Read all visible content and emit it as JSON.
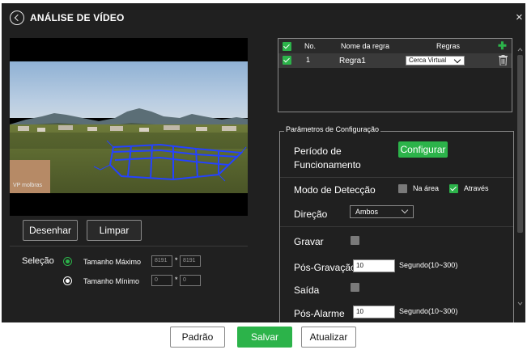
{
  "colors": {
    "accent": "#2cb34a",
    "panel": "#202020",
    "virtual_fence": "#2442ff"
  },
  "header": {
    "title": "ANÁLISE DE VÍDEO",
    "back_icon": "back-circle-icon",
    "close_icon": "close-icon",
    "close_glyph": "×"
  },
  "video": {
    "watermark": "VP molbras"
  },
  "drawing": {
    "draw_label": "Desenhar",
    "clear_label": "Limpar"
  },
  "selection": {
    "label": "Seleção",
    "max": {
      "label": "Tamanho Máximo",
      "w": "8191",
      "h": "8191",
      "selected": true
    },
    "min": {
      "label": "Tamanho Mínimo",
      "w": "0",
      "h": "0",
      "selected": false
    },
    "separator": "*"
  },
  "rules_table": {
    "headers": {
      "no": "No.",
      "name": "Nome da regra",
      "rules": "Regras"
    },
    "add_icon": "plus-icon",
    "add_glyph": "✚",
    "rows": [
      {
        "no": "1",
        "name": "Regra1",
        "rule": "Cerca Virtual",
        "checked": true
      }
    ]
  },
  "params": {
    "legend": "Parâmetros de Configuração",
    "period_label_1": "Período de",
    "period_label_2": "Funcionamento",
    "configure_label": "Configurar",
    "detection_label": "Modo de Detecção",
    "in_area_label": "Na área",
    "in_area_checked": false,
    "through_label": "Através",
    "through_checked": true,
    "direction_label": "Direção",
    "direction_value": "Ambos",
    "record_label": "Gravar",
    "record_checked": false,
    "post_record_label": "Pós-Gravação",
    "post_record_value": "10",
    "post_record_unit": "Segundo(10~300)",
    "output_label": "Saída",
    "output_checked": false,
    "post_alarm_label": "Pós-Alarme",
    "post_alarm_value": "10",
    "post_alarm_unit": "Segundo(10~300)"
  },
  "footer": {
    "default_label": "Padrão",
    "save_label": "Salvar",
    "refresh_label": "Atualizar"
  }
}
